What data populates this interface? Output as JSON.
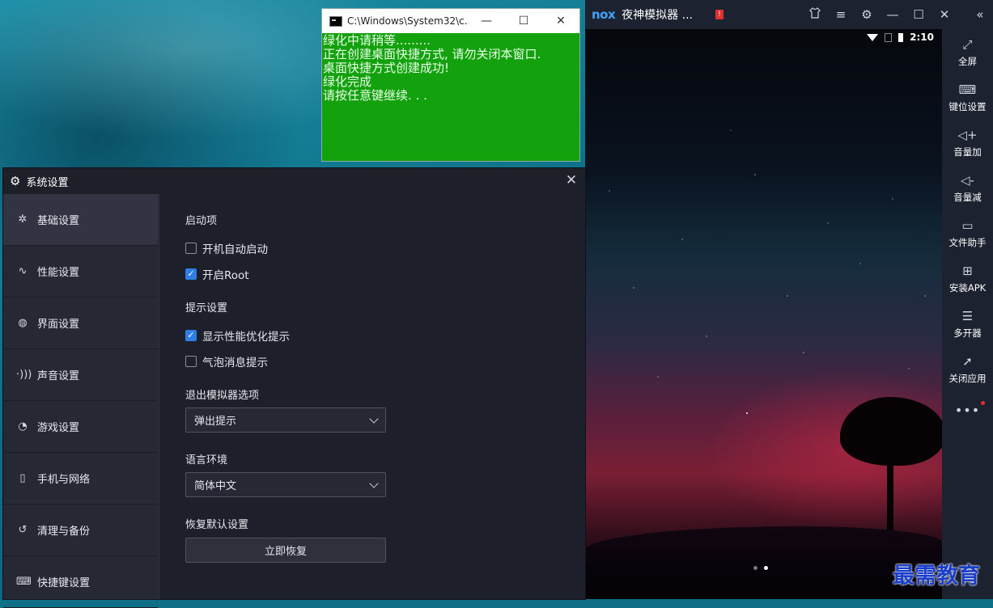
{
  "cmd": {
    "title": "C:\\Windows\\System32\\c...",
    "buttons": {
      "minimize": "—",
      "maximize": "☐",
      "close": "✕"
    },
    "lines": [
      "绿化中请稍等.........",
      "正在创建桌面快捷方式, 请勿关闭本窗口.",
      "桌面快捷方式创建成功!",
      "绿化完成",
      "请按任意键继续. . ."
    ]
  },
  "nox": {
    "logo": "nox",
    "title": "夜神模拟器 ...",
    "alert": "!",
    "titlebar_icons": [
      "shirt-icon",
      "menu-icon",
      "gear-icon",
      "minimize-icon",
      "maximize-icon",
      "close-icon",
      "collapse-icon"
    ],
    "status": {
      "time": "2:10"
    },
    "sidebar": [
      {
        "icon": "fullscreen-icon",
        "label": "全屏"
      },
      {
        "icon": "keyboard-icon",
        "label": "键位设置"
      },
      {
        "icon": "volume-up-icon",
        "label": "音量加"
      },
      {
        "icon": "volume-down-icon",
        "label": "音量减"
      },
      {
        "icon": "file-helper-icon",
        "label": "文件助手"
      },
      {
        "icon": "install-apk-icon",
        "label": "安装APK"
      },
      {
        "icon": "multi-instance-icon",
        "label": "多开器"
      },
      {
        "icon": "rocket-icon",
        "label": "关闭应用"
      }
    ],
    "more": "•••"
  },
  "settings": {
    "title": "系统设置",
    "nav": [
      {
        "icon": "puzzle-icon",
        "label": "基础设置",
        "active": true
      },
      {
        "icon": "pulse-icon",
        "label": "性能设置"
      },
      {
        "icon": "palette-icon",
        "label": "界面设置"
      },
      {
        "icon": "sound-icon",
        "label": "声音设置"
      },
      {
        "icon": "gamepad-icon",
        "label": "游戏设置"
      },
      {
        "icon": "phone-icon",
        "label": "手机与网络"
      },
      {
        "icon": "history-icon",
        "label": "清理与备份"
      },
      {
        "icon": "keyboard-icon",
        "label": "快捷键设置"
      }
    ],
    "startup": {
      "title": "启动项",
      "options": [
        {
          "label": "开机自动启动",
          "checked": false
        },
        {
          "label": "开启Root",
          "checked": true
        }
      ]
    },
    "hints": {
      "title": "提示设置",
      "options": [
        {
          "label": "显示性能优化提示",
          "checked": true
        },
        {
          "label": "气泡消息提示",
          "checked": false
        }
      ]
    },
    "exit": {
      "title": "退出模拟器选项",
      "value": "弹出提示"
    },
    "language": {
      "title": "语言环境",
      "value": "简体中文"
    },
    "restore": {
      "title": "恢复默认设置",
      "button": "立即恢复"
    }
  },
  "watermark": "最需教育",
  "colors": {
    "cmd_bg": "#13a10e",
    "checkbox_on": "#2f7ee6",
    "nox_accent": "#3fa4ff"
  }
}
